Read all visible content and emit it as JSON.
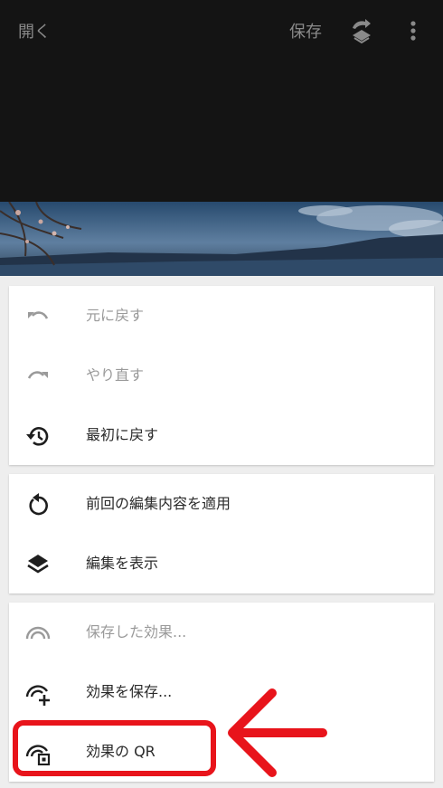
{
  "header": {
    "open_label": "開く",
    "save_label": "保存"
  },
  "menu": {
    "group1": [
      {
        "label": "元に戻す",
        "icon": "undo-icon",
        "enabled": false
      },
      {
        "label": "やり直す",
        "icon": "redo-icon",
        "enabled": false
      },
      {
        "label": "最初に戻す",
        "icon": "history-icon",
        "enabled": true
      }
    ],
    "group2": [
      {
        "label": "前回の編集内容を適用",
        "icon": "reapply-icon",
        "enabled": true
      },
      {
        "label": "編集を表示",
        "icon": "layers-icon",
        "enabled": true
      }
    ],
    "group3": [
      {
        "label": "保存した効果...",
        "icon": "saved-looks-icon",
        "enabled": false
      },
      {
        "label": "効果を保存...",
        "icon": "save-look-icon",
        "enabled": true
      },
      {
        "label": "効果の QR",
        "icon": "qr-look-icon",
        "enabled": true
      }
    ]
  },
  "colors": {
    "header_bg": "#141414",
    "highlight": "#e8141b",
    "disabled_text": "#9a9a9a",
    "text": "#2a2a2a"
  }
}
